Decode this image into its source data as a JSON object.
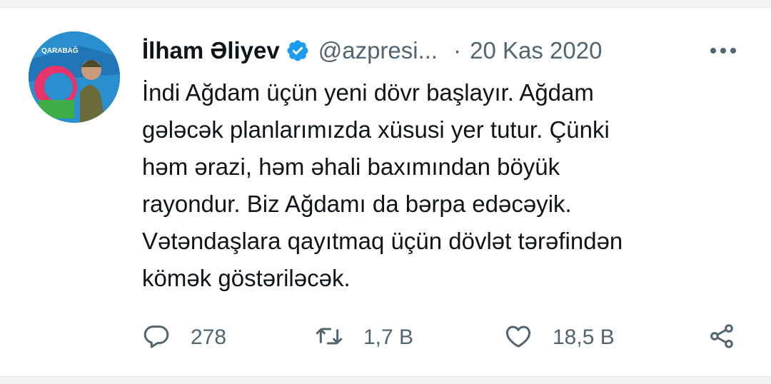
{
  "tweet": {
    "author_name": "İlham Əliyev",
    "handle": "@azpresi...",
    "separator": "·",
    "date": "20 Kas 2020",
    "text_lines": [
      "İndi Ağdam üçün yeni dövr başlayır. Ağdam",
      "gələcək planlarımızda xüsusi yer tutur. Çünki",
      "həm ərazi, həm əhali baxımından böyük",
      "rayondur. Biz Ağdamı da bərpa edəcəyik.",
      "Vətəndaşlara qayıtmaq üçün dövlət tərəfindən",
      "kömək göstəriləcək."
    ],
    "avatar_text": "QARABAĞ",
    "verified_color": "#1d9bf0",
    "accent_color": "#536471"
  },
  "actions": {
    "reply_count": "278",
    "retweet_count": "1,7 B",
    "like_count": "18,5 B"
  },
  "icons": {
    "avatar": "profile-photo",
    "verified": "verified-badge-icon",
    "more": "more-horizontal-icon",
    "reply": "reply-bubble-icon",
    "retweet": "retweet-icon",
    "like": "heart-icon",
    "share": "share-icon"
  }
}
